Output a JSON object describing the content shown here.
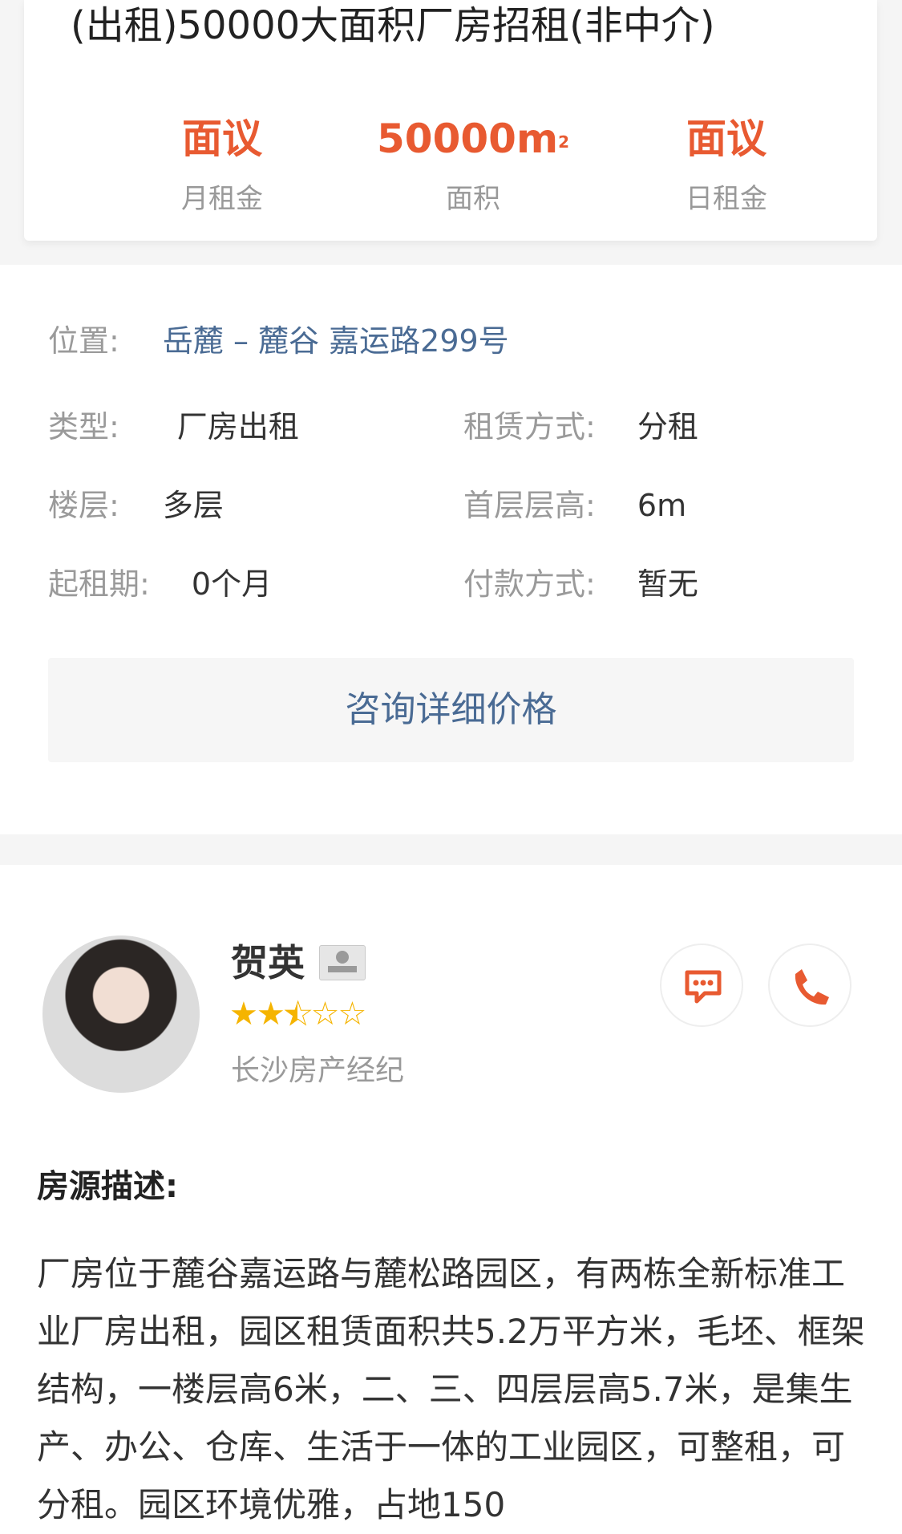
{
  "summary": {
    "title": "(出租)50000大面积厂房招租(非中介)",
    "stats": [
      {
        "value": "面议",
        "label": "月租金"
      },
      {
        "value": "50000m",
        "unit_sup": "2",
        "label": "面积"
      },
      {
        "value": "面议",
        "label": "日租金"
      }
    ]
  },
  "info": {
    "location_key": "位置:",
    "location_value": "岳麓 – 麓谷 嘉运路299号",
    "type_key": "类型:",
    "type_value": "厂房出租",
    "lease_key": "租赁方式:",
    "lease_value": "分租",
    "floor_key": "楼层:",
    "floor_value": "多层",
    "height_key": "首层层高:",
    "height_value": "6m",
    "start_key": "起租期:",
    "start_value": "0个月",
    "pay_key": "付款方式:",
    "pay_value": "暂无",
    "consult_button": "咨询详细价格"
  },
  "agent": {
    "name": "贺英",
    "rating": 2.5,
    "rating_max": 5,
    "title": "长沙房产经纪",
    "colors": {
      "accent": "#e85a31",
      "star": "#f5b400",
      "link": "#4a6b94"
    }
  },
  "description": {
    "heading": "房源描述:",
    "text": "厂房位于麓谷嘉运路与麓松路园区，有两栋全新标准工业厂房出租，园区租赁面积共5.2万平方米，毛坯、框架结构，一楼层高6米，二、三、四层层高5.7米，是集生产、办公、仓库、生活于一体的工业园区，可整租，可分租。园区环境优雅，占地150"
  }
}
